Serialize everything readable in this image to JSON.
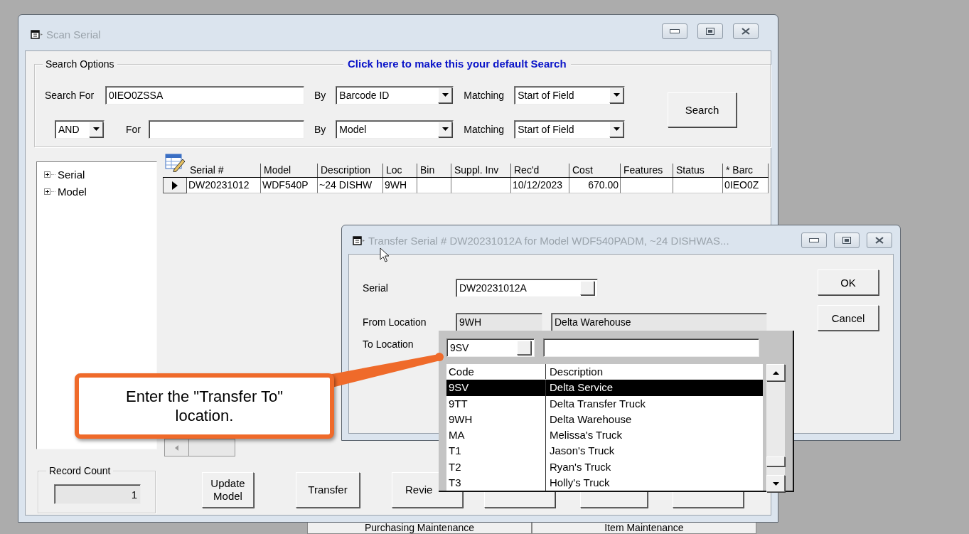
{
  "main_window": {
    "title": "Scan Serial"
  },
  "search_options": {
    "label": "Search Options",
    "default_link": "Click here to make this your default Search",
    "rows": [
      {
        "kind": "first",
        "label": "Search For",
        "value": "0IEO0ZSSA",
        "by_label": "By",
        "by": "Barcode ID",
        "matching_label": "Matching",
        "matching": "Start of Field"
      },
      {
        "kind": "joined",
        "operator": "AND",
        "label": "For",
        "by_label": "By",
        "by": "Model",
        "matching_label": "Matching",
        "matching": "Start of Field"
      }
    ],
    "search_button": "Search"
  },
  "tree": [
    {
      "label": "Serial",
      "expanded": false
    },
    {
      "label": "Model",
      "expanded": false
    }
  ],
  "grid": {
    "columns": [
      "Serial #",
      "Model",
      "Description",
      "Loc",
      "Bin",
      "Suppl. Inv",
      "Rec'd",
      "Cost",
      "Features",
      "Status",
      "* Barc"
    ],
    "rows": [
      {
        "current": true,
        "cells": [
          "DW20231012",
          "WDF540P",
          "~24 DISHW",
          "9WH",
          "",
          "",
          "10/12/2023",
          "670.00",
          "",
          "",
          "0IEO0Z"
        ]
      }
    ]
  },
  "record_count": {
    "label": "Record Count",
    "value": "1"
  },
  "buttons": [
    {
      "kind": "labeled",
      "label": "Update Model"
    },
    {
      "kind": "labeled",
      "label": "Transfer"
    },
    {
      "kind": "labeled",
      "label": "Revie"
    },
    {
      "kind": "covered"
    },
    {
      "kind": "covered"
    },
    {
      "kind": "covered"
    }
  ],
  "background_tabs": [
    "Purchasing Maintenance",
    "Item Maintenance"
  ],
  "transfer_dialog": {
    "title": "Transfer Serial # DW20231012A for Model WDF540PADM, ~24 DISHWAS...",
    "serial_label": "Serial",
    "serial": "DW20231012A",
    "from_label": "From Location",
    "from_code": "9WH",
    "from_description": "Delta Warehouse",
    "to_label": "To Location",
    "ok": "OK",
    "cancel": "Cancel"
  },
  "lookup": {
    "code": "9SV",
    "columns": [
      "Code",
      "Description"
    ],
    "rows": [
      {
        "code": "9SV",
        "description": "Delta Service",
        "selected": true
      },
      {
        "code": "9TT",
        "description": "Delta Transfer Truck",
        "selected": false
      },
      {
        "code": "9WH",
        "description": "Delta Warehouse",
        "selected": false
      },
      {
        "code": "MA",
        "description": "Melissa's Truck",
        "selected": false
      },
      {
        "code": "T1",
        "description": "Jason's Truck",
        "selected": false
      },
      {
        "code": "T2",
        "description": "Ryan's Truck",
        "selected": false
      },
      {
        "code": "T3",
        "description": "Holly's Truck",
        "selected": false
      }
    ]
  },
  "callout": {
    "text": "Enter the \"Transfer To\" location."
  }
}
